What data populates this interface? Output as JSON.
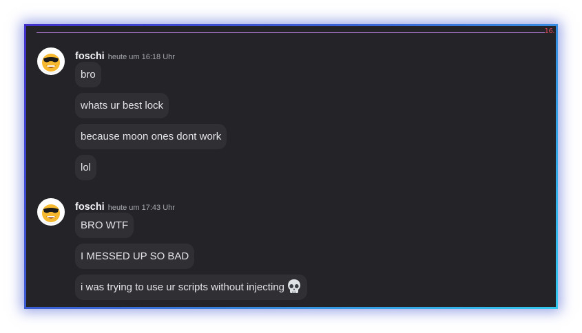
{
  "divider": {
    "date_label": "16."
  },
  "groups": [
    {
      "username": "foschi",
      "timestamp": "heute um 16:18 Uhr",
      "messages": [
        {
          "text": "bro"
        },
        {
          "text": "whats ur best lock"
        },
        {
          "text": "because moon ones dont work"
        },
        {
          "text": "lol"
        }
      ]
    },
    {
      "username": "foschi",
      "timestamp": "heute um 17:43 Uhr",
      "messages": [
        {
          "text": "BRO WTF"
        },
        {
          "text": "I MESSED UP SO BAD"
        },
        {
          "text": "i was trying to use ur scripts without injecting",
          "emoji": "skull-emoji"
        }
      ]
    }
  ],
  "colors": {
    "background": "#242428",
    "bubble": "#303034",
    "divider": "#b07ad4",
    "date_label": "#e0465a",
    "frame_gradient_start": "#4030c8",
    "frame_gradient_end": "#33c8ee"
  }
}
